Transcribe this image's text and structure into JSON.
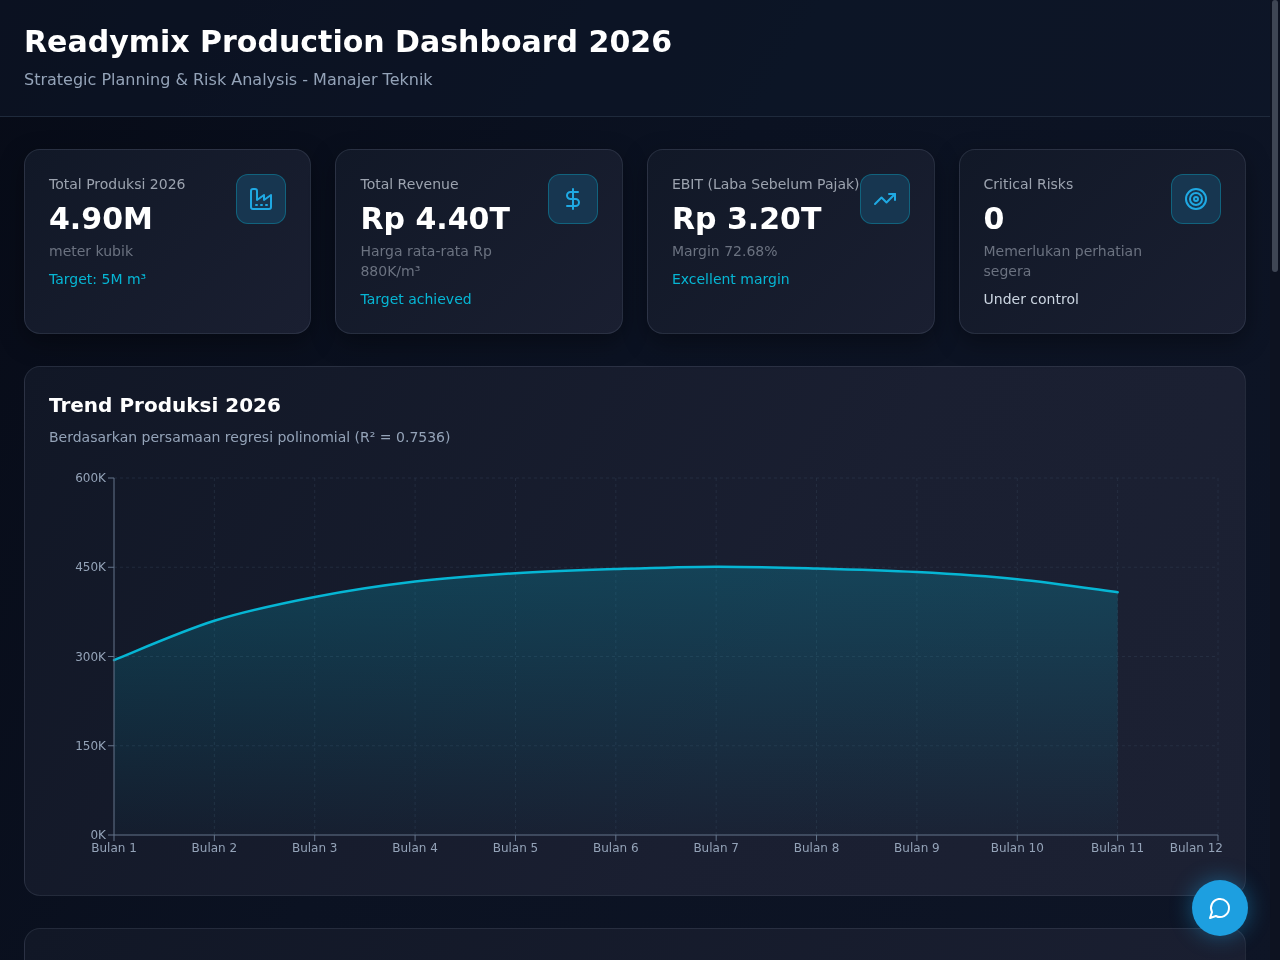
{
  "header": {
    "title": "Readymix Production Dashboard 2026",
    "subtitle": "Strategic Planning & Risk Analysis - Manajer Teknik"
  },
  "kpi_cards": [
    {
      "kind": "production",
      "label": "Total Produksi 2026",
      "value": "4.90M",
      "caption": "meter kubik",
      "note": {
        "text": "Target: 5M m³",
        "color": "#06b6d4"
      }
    },
    {
      "kind": "revenue",
      "label": "Total Revenue",
      "value": "Rp 4.40T",
      "caption": "Harga rata-rata Rp 880K/m³",
      "note": {
        "text": "Target achieved",
        "color": "#06b6d4"
      }
    },
    {
      "kind": "profit",
      "label": "EBIT (Laba Sebelum Pajak)",
      "value": "Rp 3.20T",
      "caption": "Margin 72.68%",
      "note": {
        "text": "Excellent margin",
        "color": "#06b6d4"
      }
    },
    {
      "kind": "risk",
      "label": "Critical Risks",
      "value": "0",
      "caption": "Memerlukan perhatian segera",
      "note": {
        "text": "Under control",
        "color": "#cbd5e1"
      }
    }
  ],
  "trend_chart": {
    "title": "Trend Produksi 2026",
    "subtitle": "Berdasarkan persamaan regresi polinomial (R² = 0.7536)",
    "chart_data": [
      {
        "type": "area",
        "categories": [
          "Bulan 1",
          "Bulan 2",
          "Bulan 3",
          "Bulan 4",
          "Bulan 5",
          "Bulan 6",
          "Bulan 7",
          "Bulan 8",
          "Bulan 9",
          "Bulan 10",
          "Bulan 11",
          "Bulan 12"
        ],
        "values": [
          294000,
          360000,
          400000,
          426000,
          440000,
          447000,
          451000,
          448000,
          442000,
          430000,
          408000,
          null
        ],
        "color": "#06b6d4",
        "ylim": [
          0,
          600000
        ],
        "yticks": [
          {
            "value": 0,
            "label": "0K"
          },
          {
            "value": 150000,
            "label": "150K"
          },
          {
            "value": 300000,
            "label": "300K"
          },
          {
            "value": 450000,
            "label": "450K"
          },
          {
            "value": 600000,
            "label": "600K"
          }
        ],
        "grid": true
      }
    ]
  }
}
